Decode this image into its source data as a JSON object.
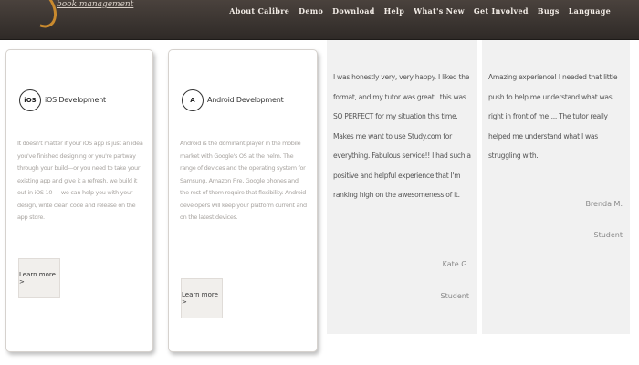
{
  "header": {
    "tagline": "book management",
    "nav": [
      "About Calibre",
      "Demo",
      "Download",
      "Help",
      "What's New",
      "Get Involved",
      "Bugs",
      "Language"
    ]
  },
  "services": [
    {
      "icon_text": "iOS",
      "title": "iOS Development",
      "description": "It doesn't matter if your iOS app is just an idea you've finished designing or you're partway through your build—or you need to take your existing app and give it a refresh, we build it out in iOS 10 — we can help you with your design, write clean code and release on the app store.",
      "button": "Learn more >"
    },
    {
      "icon_text": "A",
      "title": "Android Development",
      "description": "Android is the dominant player in the mobile market with Google's OS at the helm. The range of devices and the operating system for Samsung, Amazon Fire, Google phones and the rest of them require that flexibility. Android developers will keep your platform current and on the latest devices.",
      "button": "Learn more >"
    }
  ],
  "testimonials": [
    {
      "quote": "I was honestly very, very happy. I liked the format, and my tutor was great...this was SO PERFECT for my situation this time. Makes me want to use Study.com for everything. Fabulous service!! I had such a positive and helpful experience that I'm ranking high on the awesomeness of it.",
      "name": "Kate G.",
      "role": "Student"
    },
    {
      "quote": "Amazing experience! I needed that little push to help me understand what was right in front of me!... The tutor really helped me understand what I was struggling with.",
      "name": "Brenda M.",
      "role": "Student"
    }
  ]
}
